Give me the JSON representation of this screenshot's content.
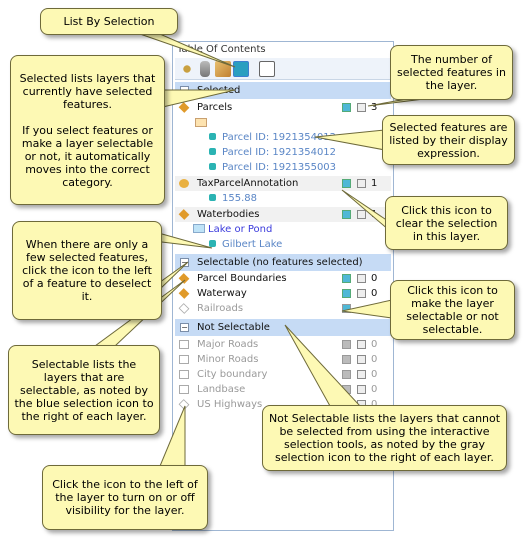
{
  "toc": {
    "title": "Table Of Contents",
    "toolbar": [
      "list-by-drawing-order",
      "list-by-source",
      "list-by-visibility",
      "list-by-selection",
      "options"
    ],
    "groups": {
      "selected": {
        "label": "Selected",
        "layers": [
          {
            "name": "Parcels",
            "count": "3",
            "features": [
              "Parcel ID: 1921354012",
              "Parcel ID: 1921354012",
              "Parcel ID: 1921355003"
            ]
          },
          {
            "name": "TaxParcelAnnotation",
            "count": "1",
            "features": [
              "155.88"
            ]
          },
          {
            "name": "Waterbodies",
            "count": "1",
            "legend_label": "Lake or Pond",
            "features": [
              "Gilbert Lake"
            ]
          }
        ]
      },
      "selectable": {
        "label": "Selectable (no features selected)",
        "layers": [
          {
            "name": "Parcel Boundaries",
            "count": "0"
          },
          {
            "name": "Waterway",
            "count": "0"
          },
          {
            "name": "Railroads",
            "count": ""
          }
        ]
      },
      "not_selectable": {
        "label": "Not Selectable",
        "layers": [
          {
            "name": "Major Roads",
            "count": "0"
          },
          {
            "name": "Minor Roads",
            "count": "0"
          },
          {
            "name": "City boundary",
            "count": "0"
          },
          {
            "name": "Landbase",
            "count": "0"
          },
          {
            "name": "US Highways",
            "count": "0"
          }
        ]
      }
    }
  },
  "callouts": {
    "list_by_selection": "List By Selection",
    "selected_lists": "Selected lists layers that currently have selected features.\n\nIf you select features or make a layer selectable or not, it automatically moves into the correct category.",
    "number_selected": "The number of selected features in the layer.",
    "display_expression": "Selected features are listed by their display expression.",
    "clear_selection": "Click this icon to clear the selection in this layer.",
    "deselect": "When there are only a few selected features, click the icon to the left of a feature to deselect it.",
    "make_selectable": "Click this icon to make the layer selectable or not selectable.",
    "selectable_lists": "Selectable lists the layers that are selectable, as noted by the blue selection icon to the right of each layer.",
    "not_selectable_lists": "Not Selectable lists the layers that cannot be selected from using the interactive selection tools, as noted by the gray selection icon to the right of each layer.",
    "visibility": "Click the icon to the left of the layer to turn on or off visibility for the layer."
  },
  "colors": {
    "callout": "#fdf9b4",
    "header": "#c6dbf5",
    "feature_text": "#5a86c6",
    "legend_text": "#3b3bdc"
  }
}
